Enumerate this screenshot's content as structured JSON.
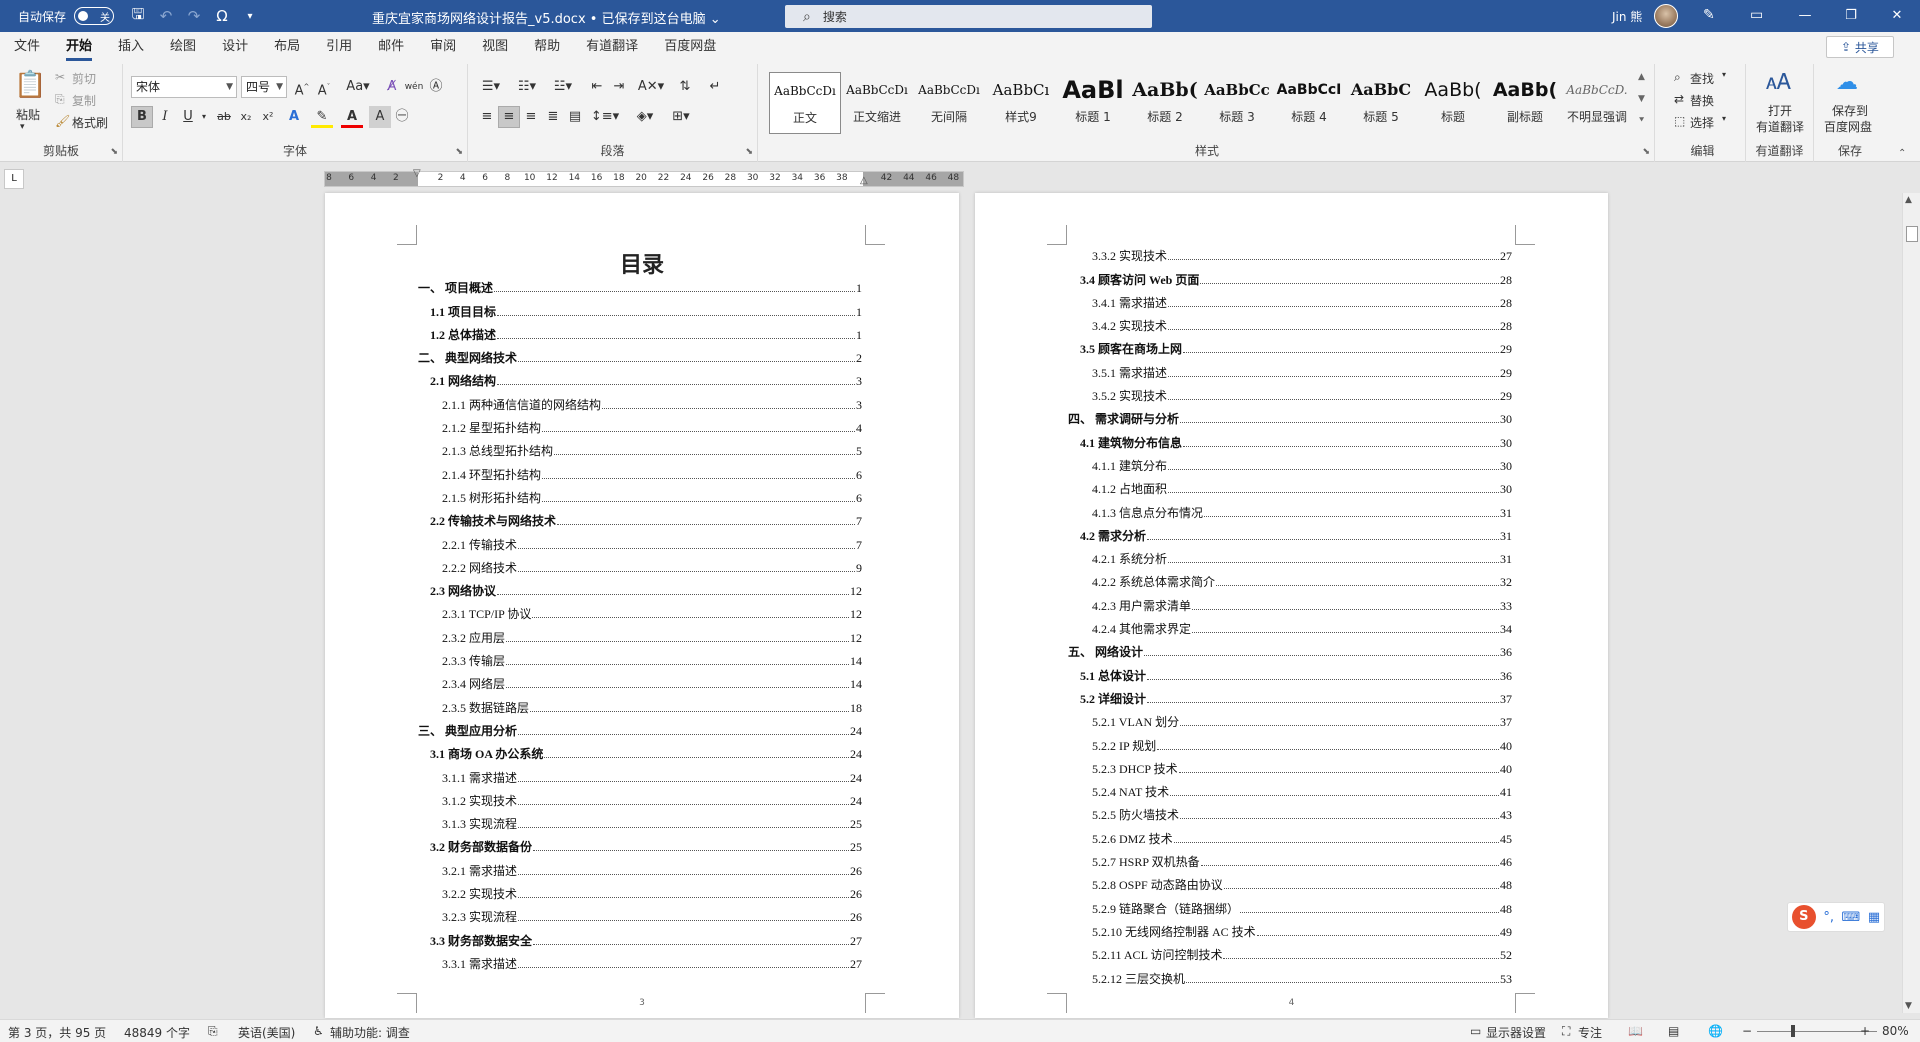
{
  "titlebar": {
    "autosave_label": "自动保存",
    "autosave_state": "关",
    "doc_title": "重庆宜家商场网络设计报告_v5.docx • 已保存到这台电脑 ⌄",
    "search_placeholder": "搜索",
    "user_name": "Jin 熊"
  },
  "tabs": [
    "文件",
    "开始",
    "插入",
    "绘图",
    "设计",
    "布局",
    "引用",
    "邮件",
    "审阅",
    "视图",
    "帮助",
    "有道翻译",
    "百度网盘"
  ],
  "active_tab": "开始",
  "share_label": "共享",
  "ribbon": {
    "clipboard": {
      "paste": "粘贴",
      "cut": "剪切",
      "copy": "复制",
      "format_painter": "格式刷",
      "label": "剪贴板"
    },
    "font": {
      "font_name": "宋体",
      "font_size": "四号",
      "label": "字体"
    },
    "paragraph": {
      "label": "段落"
    },
    "styles": {
      "label": "样式",
      "items": [
        {
          "sample": "AaBbCcDı",
          "name": "正文"
        },
        {
          "sample": "AaBbCcDı",
          "name": "正文缩进"
        },
        {
          "sample": "AaBbCcDı",
          "name": "无间隔"
        },
        {
          "sample": "AaBbCı",
          "name": "样式9"
        },
        {
          "sample": "AaBl",
          "name": "标题 1"
        },
        {
          "sample": "AaBb(",
          "name": "标题 2"
        },
        {
          "sample": "AaBbCc",
          "name": "标题 3"
        },
        {
          "sample": "AaBbCcI",
          "name": "标题 4"
        },
        {
          "sample": "AaBbC",
          "name": "标题 5"
        },
        {
          "sample": "AaBb(",
          "name": "标题"
        },
        {
          "sample": "AaBb(",
          "name": "副标题"
        },
        {
          "sample": "AaBbCcD.",
          "name": "不明显强调"
        }
      ]
    },
    "editing": {
      "find": "查找",
      "replace": "替换",
      "select": "选择",
      "label": "编辑"
    },
    "youdao": {
      "open": "打开",
      "open2": "有道翻译",
      "label": "有道翻译"
    },
    "baidu": {
      "save": "保存到",
      "save2": "百度网盘",
      "label": "保存"
    }
  },
  "ruler": {
    "numbers": [
      "8",
      "6",
      "4",
      "2",
      "",
      "2",
      "4",
      "6",
      "8",
      "10",
      "12",
      "14",
      "16",
      "18",
      "20",
      "22",
      "24",
      "26",
      "28",
      "30",
      "32",
      "34",
      "36",
      "38",
      "",
      "42",
      "44",
      "46",
      "48"
    ]
  },
  "page1": {
    "title": "目录",
    "page_number": "3",
    "entries": [
      {
        "level": 1,
        "text": "一、 项目概述",
        "page": "1"
      },
      {
        "level": 2,
        "text": "1.1  项目目标",
        "page": "1"
      },
      {
        "level": 2,
        "text": "1.2  总体描述",
        "page": "1"
      },
      {
        "level": 1,
        "text": "二、 典型网络技术",
        "page": "2"
      },
      {
        "level": 2,
        "text": "2.1  网络结构",
        "page": "3"
      },
      {
        "level": 3,
        "text": "2.1.1  两种通信信道的网络结构",
        "page": "3"
      },
      {
        "level": 3,
        "text": "2.1.2  星型拓扑结构",
        "page": "4"
      },
      {
        "level": 3,
        "text": "2.1.3  总线型拓扑结构",
        "page": "5"
      },
      {
        "level": 3,
        "text": "2.1.4  环型拓扑结构",
        "page": "6"
      },
      {
        "level": 3,
        "text": "2.1.5  树形拓扑结构",
        "page": "6"
      },
      {
        "level": 2,
        "text": "2.2  传输技术与网络技术",
        "page": "7"
      },
      {
        "level": 3,
        "text": "2.2.1  传输技术",
        "page": "7"
      },
      {
        "level": 3,
        "text": "2.2.2  网络技术",
        "page": "9"
      },
      {
        "level": 2,
        "text": "2.3  网络协议",
        "page": "12"
      },
      {
        "level": 3,
        "text": "2.3.1 TCP/IP 协议",
        "page": "12"
      },
      {
        "level": 3,
        "text": "2.3.2  应用层",
        "page": "12"
      },
      {
        "level": 3,
        "text": "2.3.3  传输层",
        "page": "14"
      },
      {
        "level": 3,
        "text": "2.3.4  网络层",
        "page": "14"
      },
      {
        "level": 3,
        "text": "2.3.5  数据链路层",
        "page": "18"
      },
      {
        "level": 1,
        "text": "三、 典型应用分析",
        "page": "24"
      },
      {
        "level": 2,
        "text": "3.1  商场 OA 办公系统",
        "page": "24"
      },
      {
        "level": 3,
        "text": "3.1.1  需求描述",
        "page": "24"
      },
      {
        "level": 3,
        "text": "3.1.2  实现技术",
        "page": "24"
      },
      {
        "level": 3,
        "text": "3.1.3  实现流程",
        "page": "25"
      },
      {
        "level": 2,
        "text": "3.2  财务部数据备份",
        "page": "25"
      },
      {
        "level": 3,
        "text": "3.2.1  需求描述",
        "page": "26"
      },
      {
        "level": 3,
        "text": "3.2.2  实现技术",
        "page": "26"
      },
      {
        "level": 3,
        "text": "3.2.3  实现流程",
        "page": "26"
      },
      {
        "level": 2,
        "text": "3.3  财务部数据安全",
        "page": "27"
      },
      {
        "level": 3,
        "text": "3.3.1  需求描述",
        "page": "27"
      }
    ]
  },
  "page2": {
    "page_number": "4",
    "entries": [
      {
        "level": 3,
        "text": "3.3.2  实现技术",
        "page": "27"
      },
      {
        "level": 2,
        "text": "3.4  顾客访问 Web 页面",
        "page": "28"
      },
      {
        "level": 3,
        "text": "3.4.1  需求描述",
        "page": "28"
      },
      {
        "level": 3,
        "text": "3.4.2  实现技术",
        "page": "28"
      },
      {
        "level": 2,
        "text": "3.5  顾客在商场上网",
        "page": "29"
      },
      {
        "level": 3,
        "text": "3.5.1  需求描述",
        "page": "29"
      },
      {
        "level": 3,
        "text": "3.5.2  实现技术",
        "page": "29"
      },
      {
        "level": 1,
        "text": "四、 需求调研与分析",
        "page": "30"
      },
      {
        "level": 2,
        "text": "4.1  建筑物分布信息",
        "page": "30"
      },
      {
        "level": 3,
        "text": "4.1.1  建筑分布",
        "page": "30"
      },
      {
        "level": 3,
        "text": "4.1.2  占地面积",
        "page": "30"
      },
      {
        "level": 3,
        "text": "4.1.3  信息点分布情况",
        "page": "31"
      },
      {
        "level": 2,
        "text": "4.2  需求分析",
        "page": "31"
      },
      {
        "level": 3,
        "text": "4.2.1  系统分析",
        "page": "31"
      },
      {
        "level": 3,
        "text": "4.2.2  系统总体需求简介",
        "page": "32"
      },
      {
        "level": 3,
        "text": "4.2.3  用户需求清单",
        "page": "33"
      },
      {
        "level": 3,
        "text": "4.2.4  其他需求界定",
        "page": "34"
      },
      {
        "level": 1,
        "text": "五、 网络设计",
        "page": "36"
      },
      {
        "level": 2,
        "text": "5.1  总体设计",
        "page": "36"
      },
      {
        "level": 2,
        "text": "5.2  详细设计",
        "page": "37"
      },
      {
        "level": 3,
        "text": "5.2.1 VLAN 划分",
        "page": "37"
      },
      {
        "level": 3,
        "text": "5.2.2 IP 规划",
        "page": "40"
      },
      {
        "level": 3,
        "text": "5.2.3 DHCP 技术",
        "page": "40"
      },
      {
        "level": 3,
        "text": "5.2.4 NAT 技术",
        "page": "41"
      },
      {
        "level": 3,
        "text": "5.2.5  防火墙技术",
        "page": "43"
      },
      {
        "level": 3,
        "text": "5.2.6 DMZ 技术",
        "page": "45"
      },
      {
        "level": 3,
        "text": "5.2.7 HSRP 双机热备",
        "page": "46"
      },
      {
        "level": 3,
        "text": "5.2.8 OSPF 动态路由协议",
        "page": "48"
      },
      {
        "level": 3,
        "text": "5.2.9  链路聚合（链路捆绑）",
        "page": "48"
      },
      {
        "level": 3,
        "text": "5.2.10  无线网络控制器 AC 技术",
        "page": "49"
      },
      {
        "level": 3,
        "text": "5.2.11 ACL 访问控制技术",
        "page": "52"
      },
      {
        "level": 3,
        "text": "5.2.12  三层交换机",
        "page": "53"
      }
    ]
  },
  "statusbar": {
    "page_info": "第 3 页，共 95 页",
    "word_count": "48849 个字",
    "language": "英语(美国)",
    "accessibility": "辅助功能: 调查",
    "display_settings": "显示器设置",
    "focus": "专注",
    "zoom": "80%"
  }
}
